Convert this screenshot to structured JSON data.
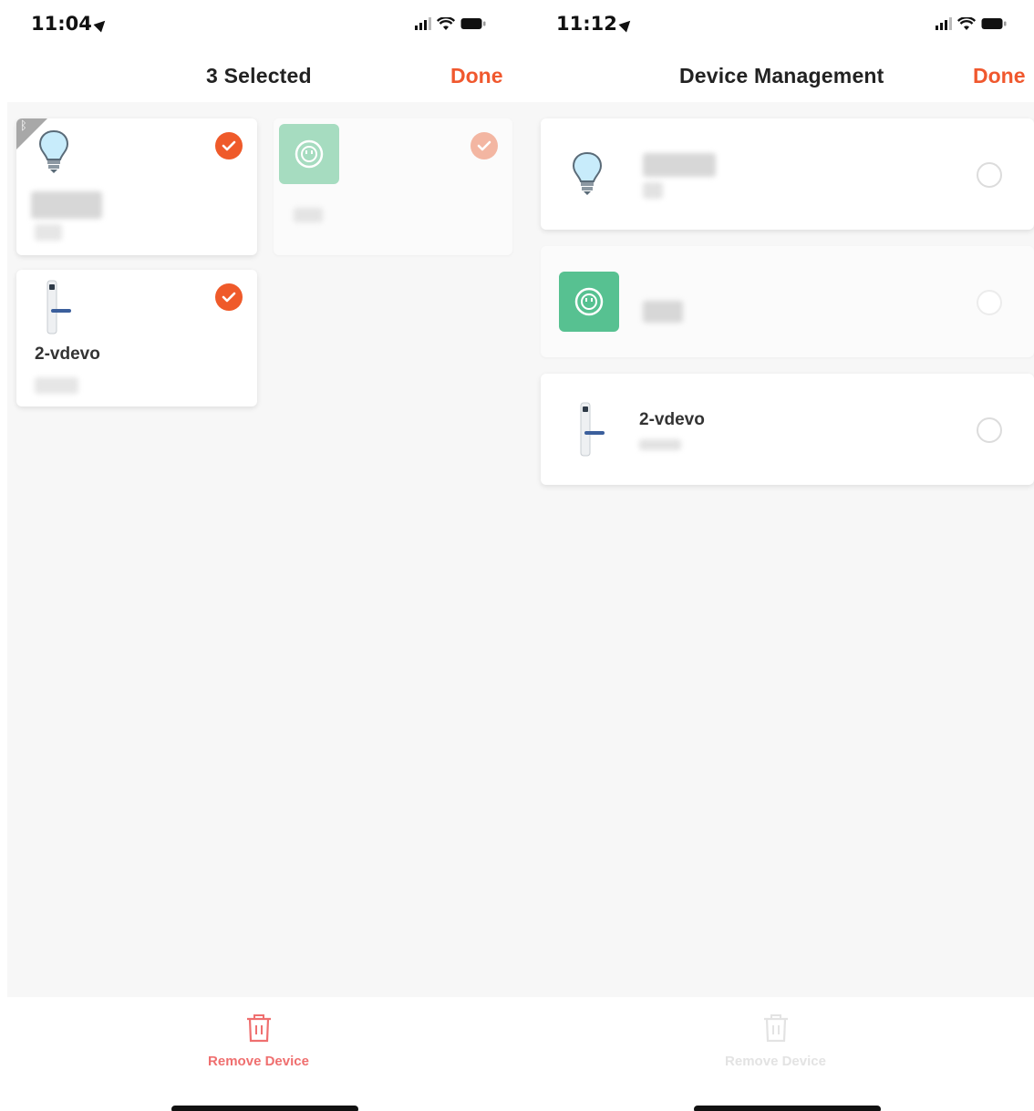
{
  "left_screen": {
    "status": {
      "time": "11:04"
    },
    "nav": {
      "title": "3 Selected",
      "done_label": "Done"
    },
    "devices": [
      {
        "name": "",
        "icon": "bulb-icon",
        "selected": true,
        "bluetooth": true
      },
      {
        "name": "",
        "icon": "socket-icon",
        "selected": true,
        "dimmed": true
      },
      {
        "name": "2-vdevo",
        "icon": "door-lock-icon",
        "selected": true
      }
    ],
    "bottom": {
      "remove_label": "Remove Device",
      "enabled": true
    }
  },
  "right_screen": {
    "status": {
      "time": "11:12"
    },
    "nav": {
      "title": "Device Management",
      "done_label": "Done"
    },
    "devices": [
      {
        "name": "",
        "icon": "bulb-icon",
        "selected": false
      },
      {
        "name": "",
        "icon": "socket-icon",
        "selected": false,
        "dimmed": true
      },
      {
        "name": "2-vdevo",
        "icon": "door-lock-icon",
        "selected": false
      }
    ],
    "bottom": {
      "remove_label": "Remove Device",
      "enabled": false
    }
  },
  "colors": {
    "accent": "#f0582e",
    "check": "#ef5a2a",
    "socket_green": "#57c191",
    "remove_red": "#ef6f6f"
  }
}
